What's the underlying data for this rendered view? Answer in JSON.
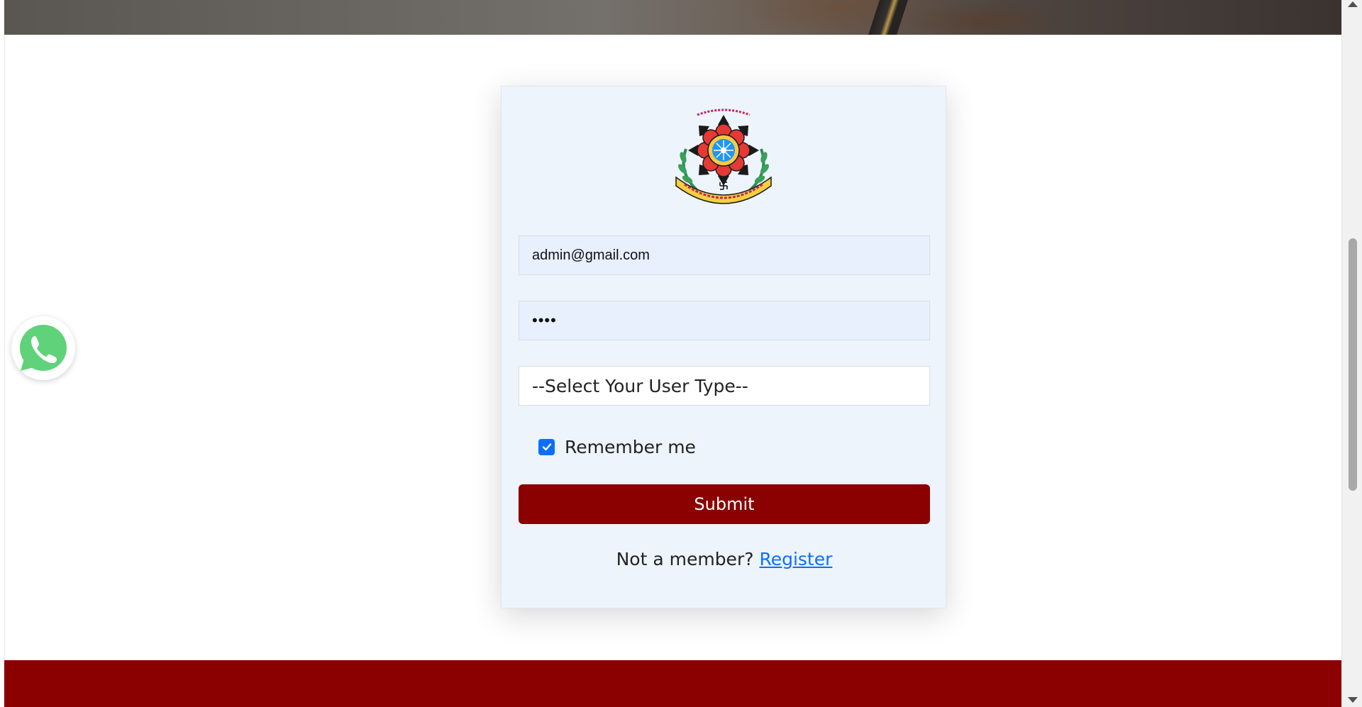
{
  "login": {
    "email_value": "admin@gmail.com",
    "password_masked": "••••",
    "user_type_placeholder": "--Select Your User Type--",
    "remember_label": "Remember me",
    "remember_checked": true,
    "submit_label": "Submit",
    "not_member_text": "Not a member?",
    "register_link": "Register"
  },
  "colors": {
    "brand_maroon": "#8b0000",
    "card_background": "#edf4fc",
    "input_autofill": "#e8f0fe",
    "link_blue": "#0d6efd",
    "whatsapp_green": "#25d366"
  },
  "icons": {
    "logo": "university-emblem",
    "whatsapp": "whatsapp-icon",
    "checkbox": "check-icon"
  }
}
